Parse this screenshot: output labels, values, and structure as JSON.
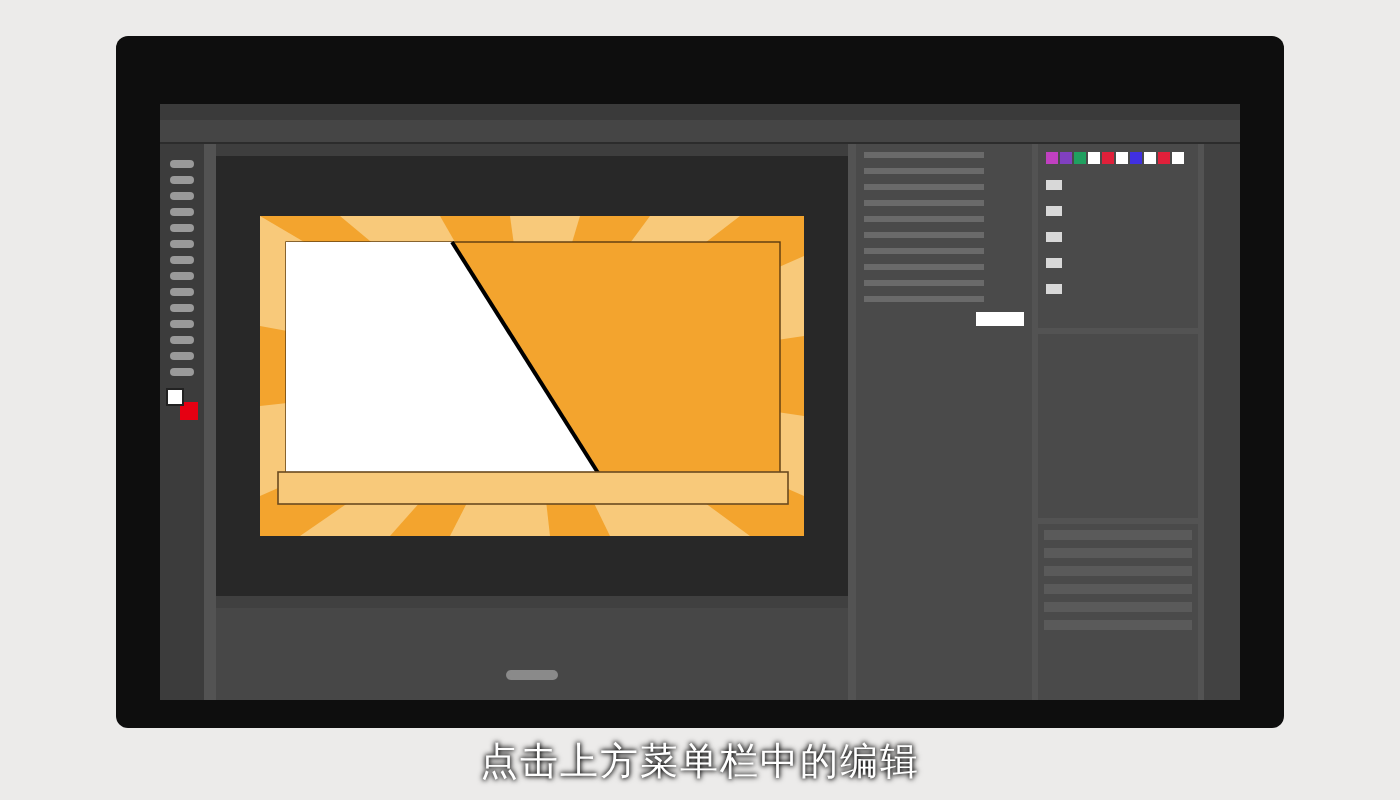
{
  "tools": {
    "foreground": {
      "color": "#ffffff"
    },
    "background": {
      "color": "#e60012"
    }
  },
  "swatches": [
    {
      "color": "#c040c0"
    },
    {
      "color": "#8040c0"
    },
    {
      "color": "#20a060"
    },
    {
      "color": "#ffffff"
    },
    {
      "color": "#e0203a"
    },
    {
      "color": "#ffffff"
    },
    {
      "color": "#4030e0"
    },
    {
      "color": "#ffffff"
    },
    {
      "color": "#e0203a"
    },
    {
      "color": "#ffffff"
    }
  ],
  "subtitle": "点击上方菜单栏中的编辑"
}
